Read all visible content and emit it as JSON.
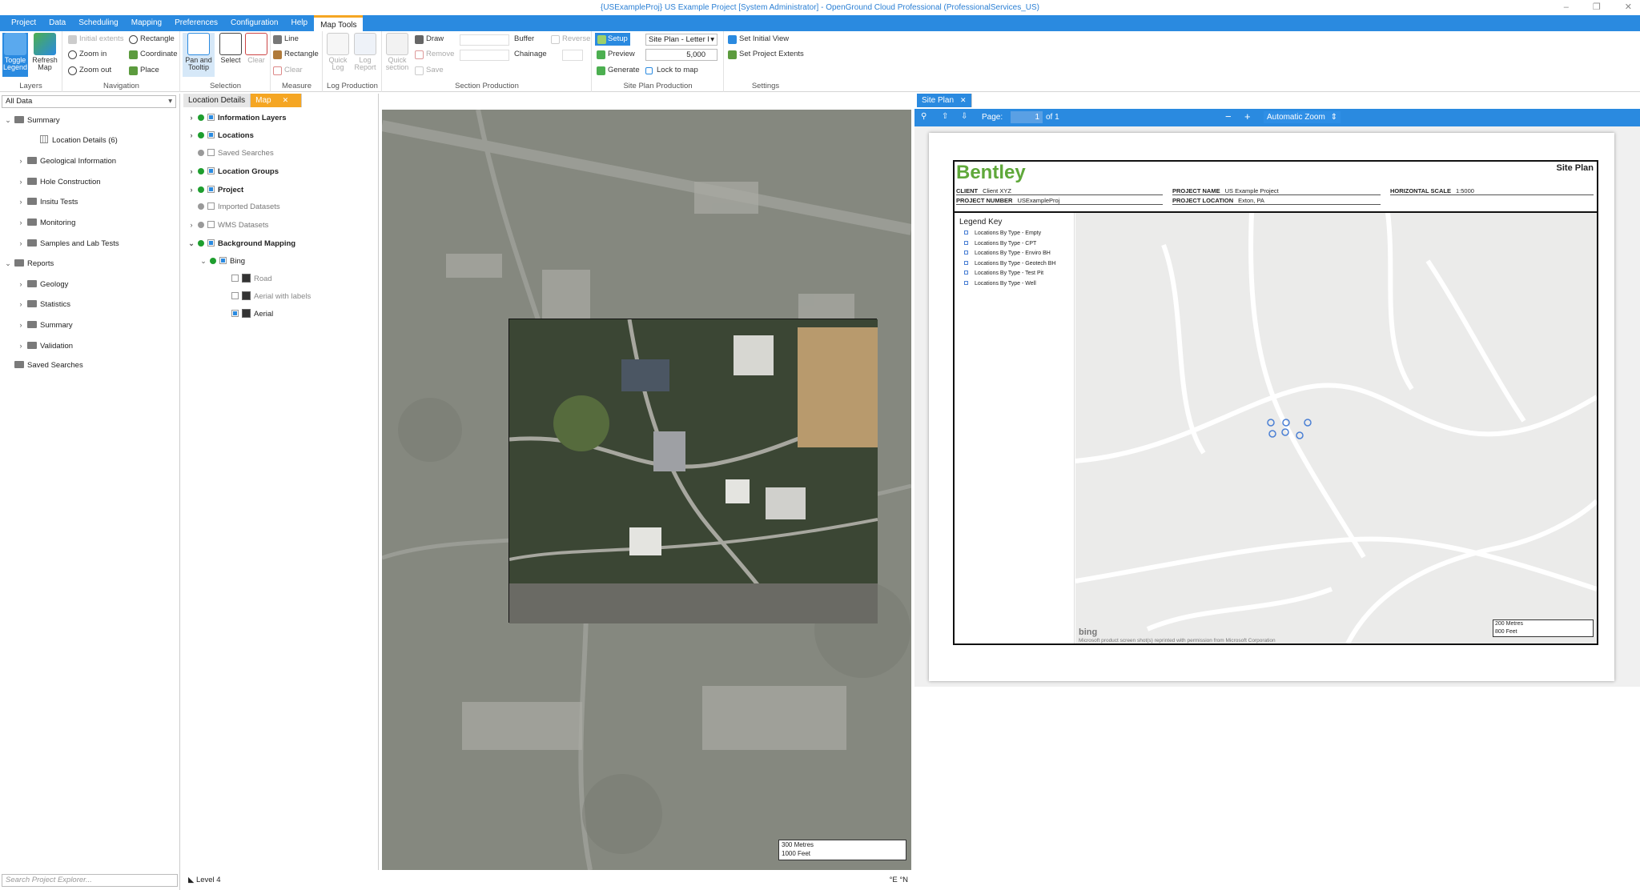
{
  "window": {
    "title": "{USExampleProj} US Example Project [System Administrator] - OpenGround Cloud Professional (ProfessionalServices_US)"
  },
  "menu": [
    "Project",
    "Data",
    "Scheduling",
    "Mapping",
    "Preferences",
    "Configuration",
    "Help",
    "Map Tools"
  ],
  "ribbon": {
    "layers": {
      "label": "Layers",
      "toggle_legend": "Toggle Legend",
      "refresh_map": "Refresh Map"
    },
    "navigation": {
      "label": "Navigation",
      "initial_extents": "Initial extents",
      "zoom_in": "Zoom in",
      "zoom_out": "Zoom out",
      "rectangle": "Rectangle",
      "coordinate": "Coordinate",
      "place": "Place"
    },
    "selection": {
      "label": "Selection",
      "pan_tooltip": "Pan and Tooltip",
      "select": "Select",
      "clear": "Clear"
    },
    "measure": {
      "label": "Measure",
      "line": "Line",
      "rectangle": "Rectangle",
      "clear": "Clear"
    },
    "log_production": {
      "label": "Log Production",
      "quick_log": "Quick Log",
      "log_report": "Log Report"
    },
    "section_production": {
      "label": "Section Production",
      "quick_section": "Quick section",
      "draw": "Draw",
      "remove": "Remove",
      "save": "Save",
      "buffer": "Buffer",
      "chainage": "Chainage",
      "reverse": "Reverse"
    },
    "site_plan_production": {
      "label": "Site Plan Production",
      "setup": "Setup",
      "preview": "Preview",
      "generate": "Generate",
      "template": "Site Plan - Letter l",
      "scale_value": "5,000",
      "lock_to_map": "Lock to map"
    },
    "settings": {
      "label": "Settings",
      "set_initial_view": "Set Initial View",
      "set_project_extents": "Set Project Extents"
    }
  },
  "explorer": {
    "filter": "All Data",
    "search_placeholder": "Search Project Explorer...",
    "items": [
      {
        "label": "Summary",
        "indent": 0,
        "chev": "v"
      },
      {
        "label": "Location Details (6)",
        "indent": 2,
        "chev": ""
      },
      {
        "label": "Geological Information",
        "indent": 1,
        "chev": ">"
      },
      {
        "label": "Hole Construction",
        "indent": 1,
        "chev": ">"
      },
      {
        "label": "Insitu Tests",
        "indent": 1,
        "chev": ">"
      },
      {
        "label": "Monitoring",
        "indent": 1,
        "chev": ">"
      },
      {
        "label": "Samples and Lab Tests",
        "indent": 1,
        "chev": ">"
      },
      {
        "label": "Reports",
        "indent": 0,
        "chev": "v"
      },
      {
        "label": "Geology",
        "indent": 1,
        "chev": ">"
      },
      {
        "label": "Statistics",
        "indent": 1,
        "chev": ">"
      },
      {
        "label": "Summary",
        "indent": 1,
        "chev": ">"
      },
      {
        "label": "Validation",
        "indent": 1,
        "chev": ">"
      },
      {
        "label": "Saved Searches",
        "indent": 0,
        "chev": ""
      }
    ]
  },
  "tabs": {
    "location_details": "Location Details",
    "map": "Map",
    "site_plan": "Site Plan"
  },
  "layers": [
    {
      "label": "Information Layers",
      "bold": true,
      "chev": ">",
      "dot": "#1e9e2e",
      "cb": "on",
      "indent": 0
    },
    {
      "label": "Locations",
      "bold": true,
      "chev": ">",
      "dot": "#1e9e2e",
      "cb": "on",
      "indent": 0
    },
    {
      "label": "Saved Searches",
      "bold": false,
      "chev": "",
      "dot": "#999",
      "cb": "off",
      "indent": 0
    },
    {
      "label": "Location Groups",
      "bold": true,
      "chev": ">",
      "dot": "#1e9e2e",
      "cb": "on",
      "indent": 0
    },
    {
      "label": "Project",
      "bold": true,
      "chev": ">",
      "dot": "#1e9e2e",
      "cb": "on",
      "indent": 0
    },
    {
      "label": "Imported Datasets",
      "bold": false,
      "chev": "",
      "dot": "#999",
      "cb": "off",
      "indent": 0
    },
    {
      "label": "WMS Datasets",
      "bold": false,
      "chev": ">",
      "dot": "#999",
      "cb": "off",
      "indent": 0
    },
    {
      "label": "Background Mapping",
      "bold": true,
      "chev": "v",
      "dot": "#1e9e2e",
      "cb": "on",
      "indent": 0
    },
    {
      "label": "Bing",
      "bold": false,
      "chev": "v",
      "dot": "#1e9e2e",
      "cb": "on",
      "indent": 1
    },
    {
      "label": "Road",
      "bold": false,
      "chev": "",
      "dot": "",
      "cb": "off",
      "indent": 2
    },
    {
      "label": "Aerial with labels",
      "bold": false,
      "chev": "",
      "dot": "",
      "cb": "off",
      "indent": 2
    },
    {
      "label": "Aerial",
      "bold": false,
      "chev": "",
      "dot": "",
      "cb": "on",
      "indent": 2
    }
  ],
  "map": {
    "scale_metres": "300 Metres",
    "scale_feet": "1000 Feet",
    "coords": "°E °N",
    "level": "Level 4"
  },
  "pdf": {
    "page_label": "Page:",
    "page_number": "1",
    "page_total": "of 1",
    "zoom": "Automatic Zoom"
  },
  "site_plan": {
    "logo": "Bentley",
    "title": "Site Plan",
    "client_label": "CLIENT",
    "client": "Client XYZ",
    "project_number_label": "PROJECT NUMBER",
    "project_number": "USExampleProj",
    "project_name_label": "PROJECT NAME",
    "project_name": "US Example Project",
    "project_location_label": "PROJECT LOCATION",
    "project_location": "Exton, PA",
    "horizontal_scale_label": "HORIZONTAL SCALE",
    "horizontal_scale": "1:5000",
    "legend_title": "Legend Key",
    "legend": [
      "Locations By Type - Empty",
      "Locations By Type - CPT",
      "Locations By Type - Enviro BH",
      "Locations By Type - Geotech BH",
      "Locations By Type - Test Pit",
      "Locations By Type - Well"
    ],
    "bing": "bing",
    "copyright": "Microsoft product screen shot(s) reprinted with permission from Microsoft Corporation",
    "scale_metres": "200 Metres",
    "scale_feet": "800 Feet"
  },
  "colors": {
    "accent": "#2a8ae0",
    "orange": "#f5a623",
    "green": "#1e9e2e"
  }
}
